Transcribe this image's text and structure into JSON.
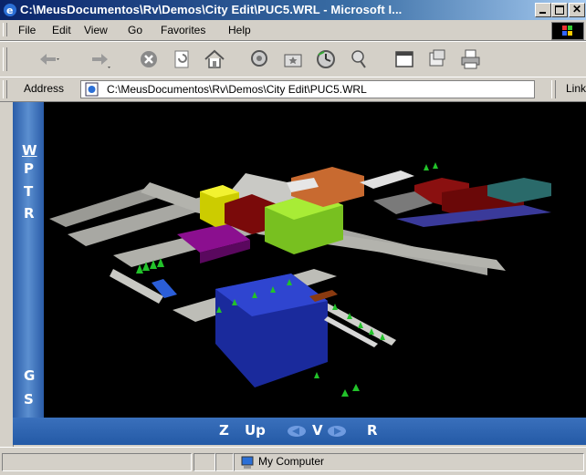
{
  "window": {
    "title": "C:\\MeusDocumentos\\Rv\\Demos\\City Edit\\PUC5.WRL - Microsoft I...",
    "controls": [
      "minimize",
      "maximize",
      "close"
    ]
  },
  "menu": {
    "file": "File",
    "edit": "Edit",
    "view": "View",
    "go": "Go",
    "favorites": "Favorites",
    "help": "Help"
  },
  "toolbar": {
    "icons": [
      "back-icon",
      "forward-icon",
      "stop-icon",
      "refresh-icon",
      "home-icon",
      "search-icon",
      "favorites-icon",
      "history-icon",
      "channels-icon",
      "fullscreen-icon",
      "mail-icon",
      "print-icon"
    ]
  },
  "address": {
    "label": "Address",
    "value": "C:\\MeusDocumentos\\Rv\\Demos\\City Edit\\PUC5.WRL",
    "links": "Links"
  },
  "vrml_nav": {
    "left": [
      "W",
      "P",
      "T",
      "R"
    ],
    "left_bottom": [
      "G",
      "S"
    ],
    "bottom": {
      "z": "Z",
      "up": "Up",
      "v": "V",
      "r": "R"
    }
  },
  "status": {
    "zone": "My Computer"
  },
  "colors": {
    "titlebar": "#0a246a",
    "chrome": "#d4d0c8",
    "nav_panel": "#3a70bc"
  }
}
